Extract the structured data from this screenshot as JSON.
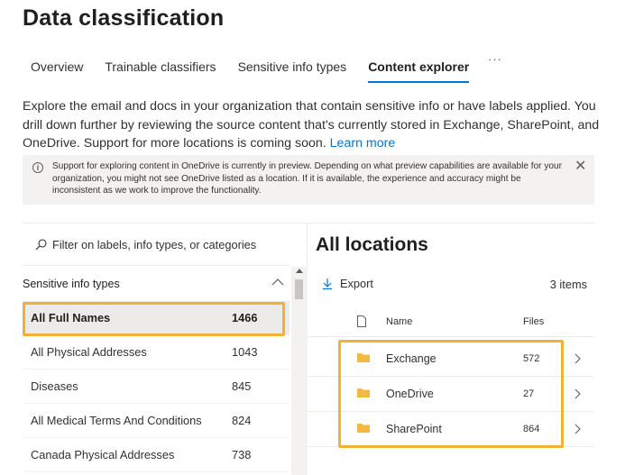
{
  "page": {
    "title": "Data classification"
  },
  "tabs": [
    {
      "label": "Overview",
      "active": false
    },
    {
      "label": "Trainable classifiers",
      "active": false
    },
    {
      "label": "Sensitive info types",
      "active": false
    },
    {
      "label": "Content explorer",
      "active": true
    }
  ],
  "tabs_more": "···",
  "description": {
    "text": "Explore the email and docs in your organization that contain sensitive info or have labels applied. You drill down further by reviewing the source content that's currently stored in Exchange, SharePoint, and OneDrive. Support for more locations is coming soon.",
    "link": "Learn more"
  },
  "banner": {
    "text": "Support for exploring content in OneDrive is currently in preview. Depending on what preview capabilities are available for your organization, you might not see OneDrive listed as a location. If it is available, the experience and accuracy might be inconsistent as we work to improve the functionality.",
    "info_icon": "info-icon",
    "close_icon": "close-icon"
  },
  "left": {
    "filter_placeholder": "Filter on labels, info types, or categories",
    "section": "Sensitive info types",
    "items": [
      {
        "name": "All Full Names",
        "count": "1466",
        "selected": true
      },
      {
        "name": "All Physical Addresses",
        "count": "1043",
        "selected": false
      },
      {
        "name": "Diseases",
        "count": "845",
        "selected": false
      },
      {
        "name": "All Medical Terms And Conditions",
        "count": "824",
        "selected": false
      },
      {
        "name": "Canada Physical Addresses",
        "count": "738",
        "selected": false
      }
    ]
  },
  "right": {
    "title": "All locations",
    "export_label": "Export",
    "items_count": "3 items",
    "columns": {
      "name": "Name",
      "files": "Files"
    },
    "locations": [
      {
        "name": "Exchange",
        "files": "572"
      },
      {
        "name": "OneDrive",
        "files": "27"
      },
      {
        "name": "SharePoint",
        "files": "864"
      }
    ]
  },
  "colors": {
    "accent": "#0078d4",
    "highlight": "#f2b134",
    "folder": "#f4b93f",
    "banner_bg": "#f3f2f1"
  }
}
